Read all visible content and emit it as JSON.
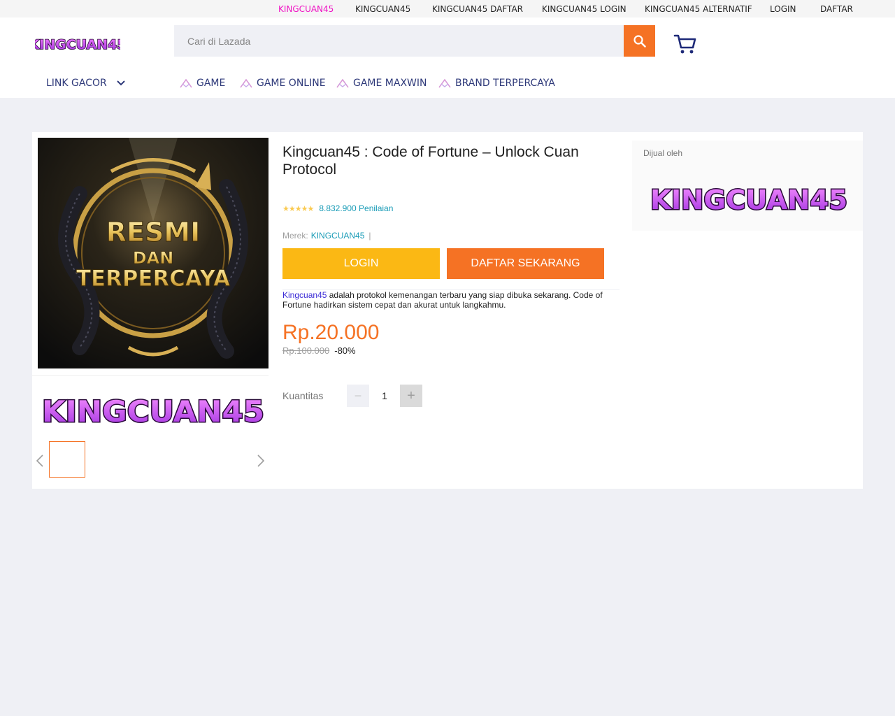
{
  "topbar": {
    "links": [
      "KINGCUAN45",
      "KINGCUAN45",
      "KINGCUAN45 DAFTAR",
      "KINGCUAN45 LOGIN",
      "KINGCUAN45 ALTERNATIF",
      "LOGIN",
      "DAFTAR"
    ]
  },
  "header": {
    "logo_text": "KINGCUAN45",
    "search_placeholder": "Cari di Lazada",
    "search_icon": "search-icon",
    "cart_icon": "cart-icon"
  },
  "catnav": {
    "dropdown_label": "LINK GACOR",
    "items": [
      "GAME",
      "GAME ONLINE",
      "GAME MAXWIN",
      "BRAND TERPERCAYA"
    ]
  },
  "gallery": {
    "hero_line1": "RESMI",
    "hero_line2": "DAN",
    "hero_line3": "TERPERCAYA",
    "logo_text": "KINGCUAN45"
  },
  "product": {
    "title": "Kingcuan45 : Code of Fortune – Unlock Cuan Protocol",
    "stars": "★★★★★",
    "rating_count": "8.832.900 Penilaian",
    "brand_label": "Merek:",
    "brand_name": "KINGCUAN45",
    "brand_sep": "|",
    "login_label": "LOGIN",
    "daftar_label": "DAFTAR SEKARANG",
    "desc_link": "Kingcuan45",
    "desc_text": " adalah protokol kemenangan terbaru yang siap dibuka sekarang. Code of Fortune hadirkan sistem cepat dan akurat untuk langkahmu.",
    "price": "Rp.20.000",
    "old_price": "Rp.100.000",
    "discount": "-80%",
    "qty_label": "Kuantitas",
    "qty_value": "1",
    "qty_minus": "−",
    "qty_plus": "+"
  },
  "seller": {
    "label": "Dijual oleh",
    "logo_text": "KINGCUAN45"
  },
  "colors": {
    "accent_orange": "#f57224",
    "accent_yellow": "#fbb814",
    "link_blue": "#1a9cb7",
    "topbar_active": "#f012c4",
    "nav_text": "#2f3a7a"
  }
}
